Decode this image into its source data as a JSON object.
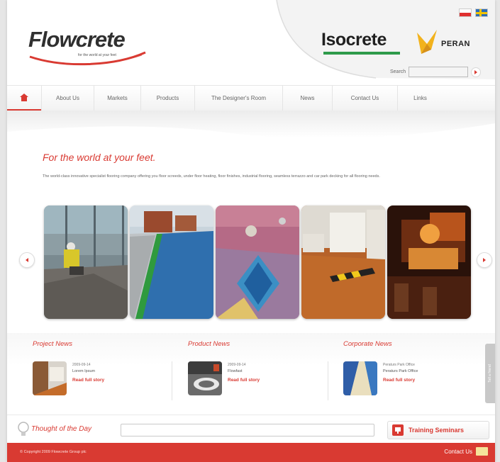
{
  "brand": {
    "name": "Flowcrete",
    "tagline": "for the world at your feet",
    "partner1": "Isocrete",
    "partner2": "PERAN"
  },
  "colors": {
    "accent": "#d93a32",
    "isocrete_green": "#2e9a4a"
  },
  "flags": [
    "poland-flag-icon",
    "sweden-flag-icon"
  ],
  "search": {
    "label": "Search",
    "value": ""
  },
  "nav": {
    "home_icon": "home-icon",
    "items": [
      "About Us",
      "Markets",
      "Products",
      "The Designer's Room",
      "News",
      "Contact Us",
      "Links"
    ]
  },
  "hero": {
    "tagline": "For the world at your feet.",
    "intro": "The world-class innovative specialist flooring company offering you floor screeds, under floor heating, floor finishes, industrial flooring, seamless terrazzo and car park decking for all flooring needs."
  },
  "carousel": {
    "prev_icon": "chevron-left-icon",
    "next_icon": "chevron-right-icon"
  },
  "news": [
    {
      "heading": "Project News",
      "date": "2009-09-14",
      "title": "Lorem Ipsum",
      "more": "Read full story"
    },
    {
      "heading": "Product News",
      "date": "2009-09-14",
      "title": "Flowfast",
      "more": "Read full story"
    },
    {
      "heading": "Corporate News",
      "date": "Peraturs Park Office",
      "title": "Peraturs Park Office",
      "more": "Read full story"
    }
  ],
  "side_tab": {
    "label": "Tell a friend"
  },
  "thought": {
    "label": "Thought of the Day",
    "value": ""
  },
  "training": {
    "label": "Training Seminars"
  },
  "footer": {
    "copyright": "© Copyright 2009 Flowcrete Group plc",
    "contact": "Contact Us"
  }
}
